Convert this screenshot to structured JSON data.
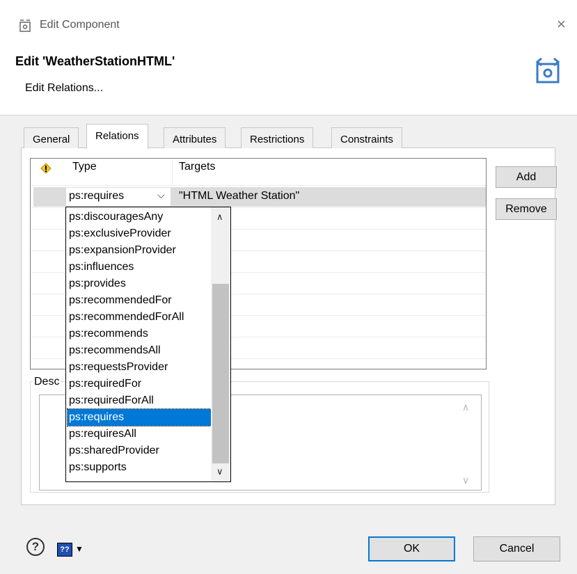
{
  "window": {
    "title": "Edit Component",
    "close_label": "×"
  },
  "header": {
    "title": "Edit 'WeatherStationHTML'",
    "subtitle": "Edit Relations..."
  },
  "tabs": [
    {
      "label": "General"
    },
    {
      "label": "Relations",
      "active": true
    },
    {
      "label": "Attributes"
    },
    {
      "label": "Restrictions"
    },
    {
      "label": "Constraints"
    }
  ],
  "table": {
    "columns": [
      "",
      "Type",
      "Targets"
    ],
    "rows": [
      {
        "type": "ps:requires",
        "targets": "\"HTML Weather Station\""
      }
    ]
  },
  "side_buttons": {
    "add": "Add",
    "remove": "Remove"
  },
  "description": {
    "label": "Desc",
    "value": ""
  },
  "dropdown": {
    "options": [
      "ps:discouragesAny",
      "ps:exclusiveProvider",
      "ps:expansionProvider",
      "ps:influences",
      "ps:provides",
      "ps:recommendedFor",
      "ps:recommendedForAll",
      "ps:recommends",
      "ps:recommendsAll",
      "ps:requestsProvider",
      "ps:requiredFor",
      "ps:requiredForAll",
      "ps:requires",
      "ps:requiresAll",
      "ps:sharedProvider",
      "ps:supports"
    ],
    "selected": "ps:requires"
  },
  "footer": {
    "help": "?",
    "context_help": "??",
    "ok": "OK",
    "cancel": "Cancel"
  },
  "colors": {
    "selection": "#0078d7",
    "ok_border": "#0078d7"
  }
}
